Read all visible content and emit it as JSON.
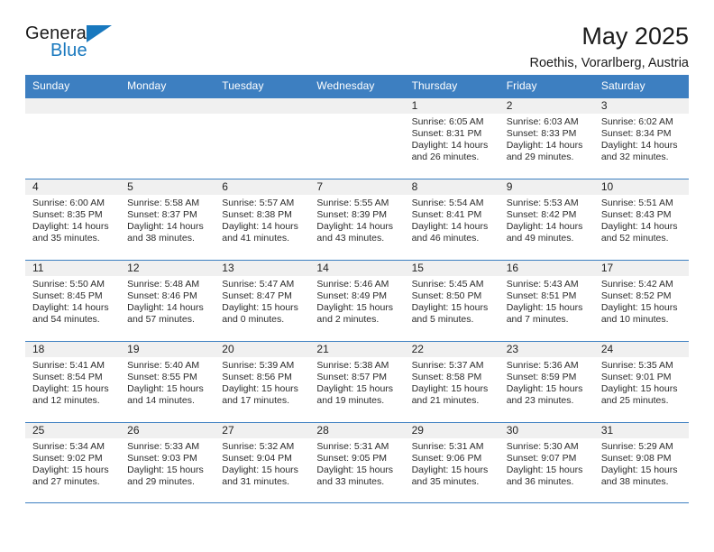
{
  "brand": {
    "name_top": "General",
    "name_bottom": "Blue",
    "accent_color": "#1878be"
  },
  "header": {
    "title": "May 2025",
    "subtitle": "Roethis, Vorarlberg, Austria"
  },
  "calendar": {
    "header_color": "#3d7fc1",
    "weekdays": [
      "Sunday",
      "Monday",
      "Tuesday",
      "Wednesday",
      "Thursday",
      "Friday",
      "Saturday"
    ],
    "weeks": [
      [
        {
          "day": "",
          "sunrise": "",
          "sunset": "",
          "daylight_line1": "",
          "daylight_line2": "",
          "empty": true
        },
        {
          "day": "",
          "sunrise": "",
          "sunset": "",
          "daylight_line1": "",
          "daylight_line2": "",
          "empty": true
        },
        {
          "day": "",
          "sunrise": "",
          "sunset": "",
          "daylight_line1": "",
          "daylight_line2": "",
          "empty": true
        },
        {
          "day": "",
          "sunrise": "",
          "sunset": "",
          "daylight_line1": "",
          "daylight_line2": "",
          "empty": true
        },
        {
          "day": "1",
          "sunrise": "Sunrise: 6:05 AM",
          "sunset": "Sunset: 8:31 PM",
          "daylight_line1": "Daylight: 14 hours",
          "daylight_line2": "and 26 minutes."
        },
        {
          "day": "2",
          "sunrise": "Sunrise: 6:03 AM",
          "sunset": "Sunset: 8:33 PM",
          "daylight_line1": "Daylight: 14 hours",
          "daylight_line2": "and 29 minutes."
        },
        {
          "day": "3",
          "sunrise": "Sunrise: 6:02 AM",
          "sunset": "Sunset: 8:34 PM",
          "daylight_line1": "Daylight: 14 hours",
          "daylight_line2": "and 32 minutes."
        }
      ],
      [
        {
          "day": "4",
          "sunrise": "Sunrise: 6:00 AM",
          "sunset": "Sunset: 8:35 PM",
          "daylight_line1": "Daylight: 14 hours",
          "daylight_line2": "and 35 minutes."
        },
        {
          "day": "5",
          "sunrise": "Sunrise: 5:58 AM",
          "sunset": "Sunset: 8:37 PM",
          "daylight_line1": "Daylight: 14 hours",
          "daylight_line2": "and 38 minutes."
        },
        {
          "day": "6",
          "sunrise": "Sunrise: 5:57 AM",
          "sunset": "Sunset: 8:38 PM",
          "daylight_line1": "Daylight: 14 hours",
          "daylight_line2": "and 41 minutes."
        },
        {
          "day": "7",
          "sunrise": "Sunrise: 5:55 AM",
          "sunset": "Sunset: 8:39 PM",
          "daylight_line1": "Daylight: 14 hours",
          "daylight_line2": "and 43 minutes."
        },
        {
          "day": "8",
          "sunrise": "Sunrise: 5:54 AM",
          "sunset": "Sunset: 8:41 PM",
          "daylight_line1": "Daylight: 14 hours",
          "daylight_line2": "and 46 minutes."
        },
        {
          "day": "9",
          "sunrise": "Sunrise: 5:53 AM",
          "sunset": "Sunset: 8:42 PM",
          "daylight_line1": "Daylight: 14 hours",
          "daylight_line2": "and 49 minutes."
        },
        {
          "day": "10",
          "sunrise": "Sunrise: 5:51 AM",
          "sunset": "Sunset: 8:43 PM",
          "daylight_line1": "Daylight: 14 hours",
          "daylight_line2": "and 52 minutes."
        }
      ],
      [
        {
          "day": "11",
          "sunrise": "Sunrise: 5:50 AM",
          "sunset": "Sunset: 8:45 PM",
          "daylight_line1": "Daylight: 14 hours",
          "daylight_line2": "and 54 minutes."
        },
        {
          "day": "12",
          "sunrise": "Sunrise: 5:48 AM",
          "sunset": "Sunset: 8:46 PM",
          "daylight_line1": "Daylight: 14 hours",
          "daylight_line2": "and 57 minutes."
        },
        {
          "day": "13",
          "sunrise": "Sunrise: 5:47 AM",
          "sunset": "Sunset: 8:47 PM",
          "daylight_line1": "Daylight: 15 hours",
          "daylight_line2": "and 0 minutes."
        },
        {
          "day": "14",
          "sunrise": "Sunrise: 5:46 AM",
          "sunset": "Sunset: 8:49 PM",
          "daylight_line1": "Daylight: 15 hours",
          "daylight_line2": "and 2 minutes."
        },
        {
          "day": "15",
          "sunrise": "Sunrise: 5:45 AM",
          "sunset": "Sunset: 8:50 PM",
          "daylight_line1": "Daylight: 15 hours",
          "daylight_line2": "and 5 minutes."
        },
        {
          "day": "16",
          "sunrise": "Sunrise: 5:43 AM",
          "sunset": "Sunset: 8:51 PM",
          "daylight_line1": "Daylight: 15 hours",
          "daylight_line2": "and 7 minutes."
        },
        {
          "day": "17",
          "sunrise": "Sunrise: 5:42 AM",
          "sunset": "Sunset: 8:52 PM",
          "daylight_line1": "Daylight: 15 hours",
          "daylight_line2": "and 10 minutes."
        }
      ],
      [
        {
          "day": "18",
          "sunrise": "Sunrise: 5:41 AM",
          "sunset": "Sunset: 8:54 PM",
          "daylight_line1": "Daylight: 15 hours",
          "daylight_line2": "and 12 minutes."
        },
        {
          "day": "19",
          "sunrise": "Sunrise: 5:40 AM",
          "sunset": "Sunset: 8:55 PM",
          "daylight_line1": "Daylight: 15 hours",
          "daylight_line2": "and 14 minutes."
        },
        {
          "day": "20",
          "sunrise": "Sunrise: 5:39 AM",
          "sunset": "Sunset: 8:56 PM",
          "daylight_line1": "Daylight: 15 hours",
          "daylight_line2": "and 17 minutes."
        },
        {
          "day": "21",
          "sunrise": "Sunrise: 5:38 AM",
          "sunset": "Sunset: 8:57 PM",
          "daylight_line1": "Daylight: 15 hours",
          "daylight_line2": "and 19 minutes."
        },
        {
          "day": "22",
          "sunrise": "Sunrise: 5:37 AM",
          "sunset": "Sunset: 8:58 PM",
          "daylight_line1": "Daylight: 15 hours",
          "daylight_line2": "and 21 minutes."
        },
        {
          "day": "23",
          "sunrise": "Sunrise: 5:36 AM",
          "sunset": "Sunset: 8:59 PM",
          "daylight_line1": "Daylight: 15 hours",
          "daylight_line2": "and 23 minutes."
        },
        {
          "day": "24",
          "sunrise": "Sunrise: 5:35 AM",
          "sunset": "Sunset: 9:01 PM",
          "daylight_line1": "Daylight: 15 hours",
          "daylight_line2": "and 25 minutes."
        }
      ],
      [
        {
          "day": "25",
          "sunrise": "Sunrise: 5:34 AM",
          "sunset": "Sunset: 9:02 PM",
          "daylight_line1": "Daylight: 15 hours",
          "daylight_line2": "and 27 minutes."
        },
        {
          "day": "26",
          "sunrise": "Sunrise: 5:33 AM",
          "sunset": "Sunset: 9:03 PM",
          "daylight_line1": "Daylight: 15 hours",
          "daylight_line2": "and 29 minutes."
        },
        {
          "day": "27",
          "sunrise": "Sunrise: 5:32 AM",
          "sunset": "Sunset: 9:04 PM",
          "daylight_line1": "Daylight: 15 hours",
          "daylight_line2": "and 31 minutes."
        },
        {
          "day": "28",
          "sunrise": "Sunrise: 5:31 AM",
          "sunset": "Sunset: 9:05 PM",
          "daylight_line1": "Daylight: 15 hours",
          "daylight_line2": "and 33 minutes."
        },
        {
          "day": "29",
          "sunrise": "Sunrise: 5:31 AM",
          "sunset": "Sunset: 9:06 PM",
          "daylight_line1": "Daylight: 15 hours",
          "daylight_line2": "and 35 minutes."
        },
        {
          "day": "30",
          "sunrise": "Sunrise: 5:30 AM",
          "sunset": "Sunset: 9:07 PM",
          "daylight_line1": "Daylight: 15 hours",
          "daylight_line2": "and 36 minutes."
        },
        {
          "day": "31",
          "sunrise": "Sunrise: 5:29 AM",
          "sunset": "Sunset: 9:08 PM",
          "daylight_line1": "Daylight: 15 hours",
          "daylight_line2": "and 38 minutes."
        }
      ]
    ]
  }
}
